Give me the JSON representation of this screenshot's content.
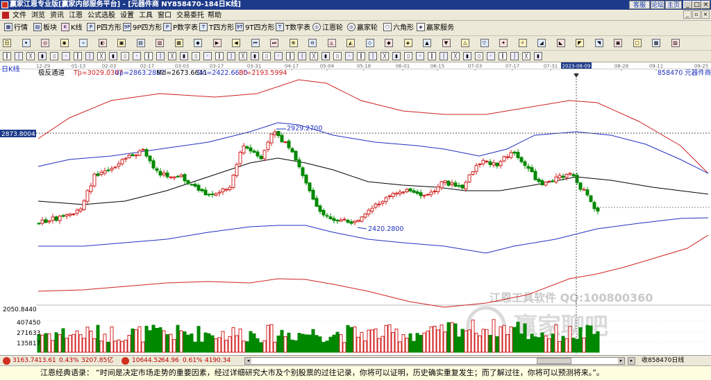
{
  "window": {
    "title": "赢家江恩专业版[赢家内部服务平台] - [元器件商  NY858470-184日K线]",
    "links": [
      "客服",
      "论坛",
      "主页"
    ]
  },
  "menu": [
    "文件",
    "浏览",
    "资讯",
    "江恩",
    "公式选股",
    "设置",
    "工具",
    "窗口",
    "交易委托",
    "帮助"
  ],
  "toolbar": [
    "行情",
    "板块",
    "K线",
    "P四方形",
    "9P四方形",
    "P数字表",
    "T四方形",
    "9T四方形",
    "T数字表",
    "江恩轮",
    "赢家轮",
    "六角形",
    "赢家服务"
  ],
  "chart": {
    "period_label": "日K线",
    "indicator_name": "极反通道",
    "indicator_values": [
      {
        "label": "Tp=3029.0347",
        "color": "#d02020"
      },
      {
        "label": "Up=2863.2867",
        "color": "#2030c0"
      },
      {
        "label": "Md=2673.6641",
        "color": "#000000"
      },
      {
        "label": "Dn=2422.6630",
        "color": "#2030c0"
      },
      {
        "label": "Bt=2193.5994",
        "color": "#d02020"
      }
    ],
    "code_label": "858470 元器件商",
    "crosshair_price": "2873.8004",
    "crosshair_date": "2023-08-09",
    "high_label": "2929.2700",
    "low_label": "2420.2800",
    "date_ticks": [
      "12-29",
      "01-13",
      "02-03",
      "02-17",
      "03-03",
      "03-17",
      "03-31",
      "04-17",
      "05-04",
      "05-18",
      "06-01",
      "06-15",
      "07-03",
      "07-17",
      "07-31",
      "2023-08-09",
      "08-28",
      "09-11",
      "09-25"
    ],
    "volume_ticks": [
      "2050.8440",
      "407450",
      "271633",
      "135817"
    ],
    "watermark_line1": "江恩工具软件  QQ:100800360",
    "watermark_line2": "赢家聊吧"
  },
  "chart_data": {
    "type": "candlestick",
    "period": "daily",
    "date_range": [
      "12-29",
      "09-25"
    ],
    "y_range_approx": [
      2193.5994,
      3029.0347
    ],
    "last_values": {
      "Tp": 3029.0347,
      "Up": 2863.2867,
      "Md": 2673.6641,
      "Dn": 2422.663,
      "Bt": 2193.5994
    },
    "marked_high": 2929.27,
    "marked_low": 2420.28,
    "volume_axis": [
      2050.844,
      407450,
      271633,
      135817
    ]
  },
  "statusbar": {
    "index1_value": "3163.74",
    "index1_change": "13.61",
    "index1_pct": "0.43%",
    "index1_amount": "3207.85亿",
    "index2_value": "10644.52",
    "index2_change": "64.96",
    "index2_pct": "0.61%",
    "index2_amount": "4190.34",
    "right_text": "收858470日线"
  },
  "quote": {
    "label": "江恩经典语录：",
    "text": "“时间是决定市场走势的重要因素，经过详细研究大市及个别股票的过往记录，你将可以证明，历史确实重复发生；而了解过往，你将可以预测将来。”。"
  },
  "colors": {
    "up": "#d02020",
    "down": "#008800",
    "band_outer": "#d02020",
    "band_inner": "#2030c0",
    "mid": "#000000"
  }
}
